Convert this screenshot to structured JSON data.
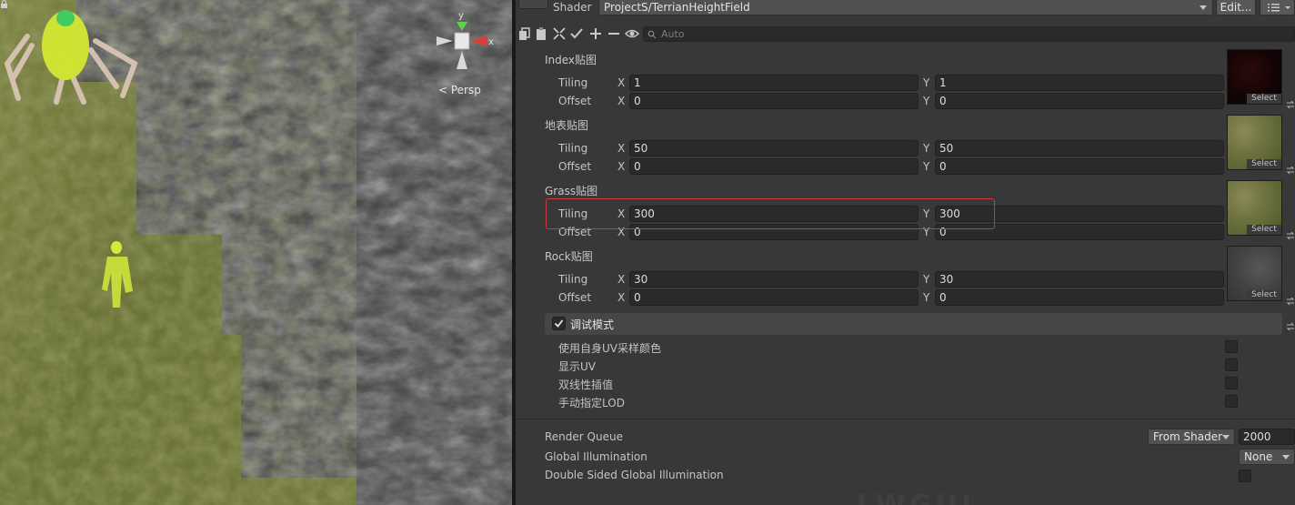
{
  "scene": {
    "view_label": "< Persp",
    "gizmo": {
      "y_label": "y",
      "x_label": "x"
    }
  },
  "inspector": {
    "shader_label": "Shader",
    "shader_value": "ProjectS/TerrianHeightField",
    "edit_label": "Edit...",
    "search_placeholder": "Auto",
    "sections": [
      {
        "title": "Index贴图",
        "tiling": {
          "label": "Tiling",
          "x": "1",
          "y": "1"
        },
        "offset": {
          "label": "Offset",
          "x": "0",
          "y": "0"
        },
        "select": "Select"
      },
      {
        "title": "地表贴图",
        "tiling": {
          "label": "Tiling",
          "x": "50",
          "y": "50"
        },
        "offset": {
          "label": "Offset",
          "x": "0",
          "y": "0"
        },
        "select": "Select"
      },
      {
        "title": "Grass贴图",
        "tiling": {
          "label": "Tiling",
          "x": "300",
          "y": "300"
        },
        "offset": {
          "label": "Offset",
          "x": "0",
          "y": "0"
        },
        "select": "Select"
      },
      {
        "title": "Rock贴图",
        "tiling": {
          "label": "Tiling",
          "x": "30",
          "y": "30"
        },
        "offset": {
          "label": "Offset",
          "x": "0",
          "y": "0"
        },
        "select": "Select"
      }
    ],
    "axis_x": "X",
    "axis_y": "Y",
    "debug": {
      "title": "调试模式",
      "checked": true,
      "options": [
        "使用自身UV采样颜色",
        "显示UV",
        "双线性插值",
        "手动指定LOD"
      ]
    },
    "render_queue": {
      "label": "Render Queue",
      "mode": "From Shader",
      "value": "2000"
    },
    "global_illumination": {
      "label": "Global Illumination",
      "value": "None"
    },
    "double_sided_gi": {
      "label": "Double Sided Global Illumination"
    },
    "watermark": "LWGUI"
  },
  "colors": {
    "highlight": "#cc3a3a",
    "panel_bg": "#383838",
    "field_bg": "#2a2a2a"
  }
}
